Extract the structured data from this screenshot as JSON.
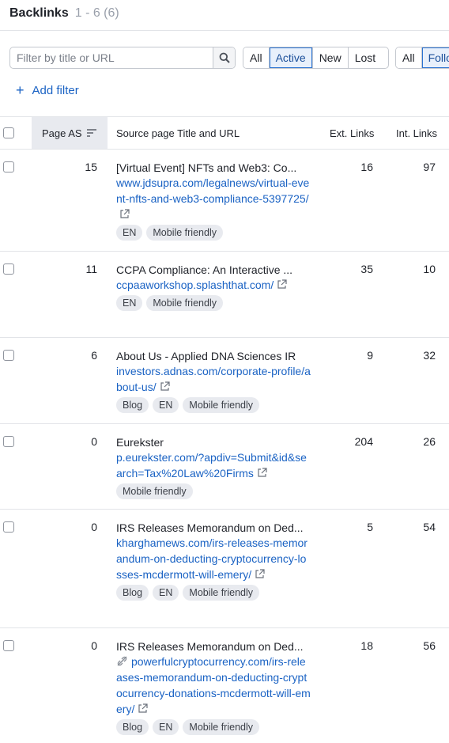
{
  "header": {
    "title": "Backlinks",
    "range": "1 - 6 (6)"
  },
  "search": {
    "placeholder": "Filter by title or URL",
    "icon": "search-icon"
  },
  "status_filter": {
    "options": [
      "All",
      "Active",
      "New",
      "Lost"
    ],
    "selected": "Active"
  },
  "follow_filter": {
    "options": [
      "All",
      "Follow"
    ],
    "selected": "Follow",
    "visible_label": "Follo"
  },
  "add_filter": {
    "label": "Add filter"
  },
  "table": {
    "headers": {
      "page_as": "Page AS",
      "source": "Source page Title and URL",
      "ext_links": "Ext. Links",
      "int_links": "Int. Links"
    },
    "rows": [
      {
        "page_as": "15",
        "title": "[Virtual Event] NFTs and Web3: Co...",
        "url": "www.jdsupra.com/legalnews/virtual-event-nfts-and-web3-compliance-5397725/",
        "tags": [
          "EN",
          "Mobile friendly"
        ],
        "ext_links": "16",
        "int_links": "97"
      },
      {
        "page_as": "11",
        "title": "CCPA Compliance: An Interactive ...",
        "url": "ccpaaworkshop.splashthat.com/",
        "tags": [
          "EN",
          "Mobile friendly"
        ],
        "ext_links": "35",
        "int_links": "10"
      },
      {
        "page_as": "6",
        "title": "About Us - Applied DNA Sciences IR",
        "url": "investors.adnas.com/corporate-profile/about-us/",
        "tags": [
          "Blog",
          "EN",
          "Mobile friendly"
        ],
        "ext_links": "9",
        "int_links": "32"
      },
      {
        "page_as": "0",
        "title": "Eurekster",
        "url": "p.eurekster.com/?apdiv=Submit&id&search=Tax%20Law%20Firms",
        "tags": [
          "Mobile friendly"
        ],
        "ext_links": "204",
        "int_links": "26"
      },
      {
        "page_as": "0",
        "title": "IRS Releases Memorandum on Ded...",
        "url": "kharghamews.com/irs-releases-memorandum-on-deducting-cryptocurrency-losses-mcdermott-will-emery/",
        "tags": [
          "Blog",
          "EN",
          "Mobile friendly"
        ],
        "ext_links": "5",
        "int_links": "54"
      },
      {
        "page_as": "0",
        "title": "IRS Releases Memorandum on Ded...",
        "url": "powerfulcryptocurrency.com/irs-releases-memorandum-on-deducting-cryptocurrency-donations-mcdermott-will-emery/",
        "tags": [
          "Blog",
          "EN",
          "Mobile friendly"
        ],
        "ext_links": "18",
        "int_links": "56",
        "nofollow": true
      }
    ]
  },
  "colors": {
    "link": "#1b63c4",
    "selected_bg": "#e8f0fb",
    "selected_border": "#2b73d2",
    "tag_bg": "#e8eaef"
  }
}
